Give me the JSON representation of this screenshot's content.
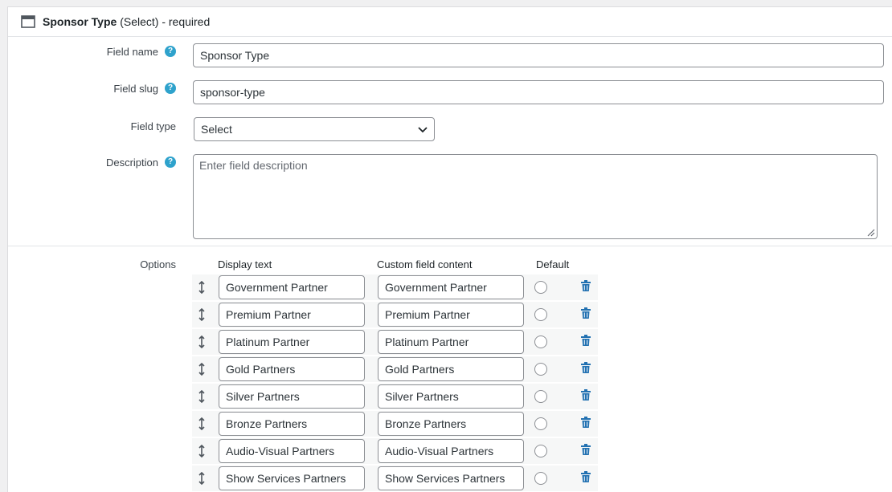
{
  "header": {
    "icon": "window-icon",
    "field_title": "Sponsor Type",
    "field_meta": " (Select) - required"
  },
  "field_name": {
    "label": "Field name",
    "value": "Sponsor Type"
  },
  "field_slug": {
    "label": "Field slug",
    "value": "sponsor-type"
  },
  "field_type": {
    "label": "Field type",
    "value": "Select"
  },
  "description": {
    "label": "Description",
    "placeholder": "Enter field description"
  },
  "help_glyph": "?",
  "options": {
    "label": "Options",
    "col_display": "Display text",
    "col_custom": "Custom field content",
    "col_default": "Default",
    "rows": [
      {
        "display": "Government Partner",
        "custom": "Government Partner"
      },
      {
        "display": "Premium Partner",
        "custom": "Premium Partner"
      },
      {
        "display": "Platinum Partner",
        "custom": "Platinum Partner"
      },
      {
        "display": "Gold Partners",
        "custom": "Gold Partners"
      },
      {
        "display": "Silver Partners",
        "custom": "Silver Partners"
      },
      {
        "display": "Bronze Partners",
        "custom": "Bronze Partners"
      },
      {
        "display": "Audio-Visual Partners",
        "custom": "Audio-Visual Partners"
      },
      {
        "display": "Show Services Partners",
        "custom": "Show Services Partners"
      }
    ]
  },
  "colors": {
    "accent": "#2ea2cc",
    "delete": "#2271b1",
    "border": "#8c8f94"
  }
}
